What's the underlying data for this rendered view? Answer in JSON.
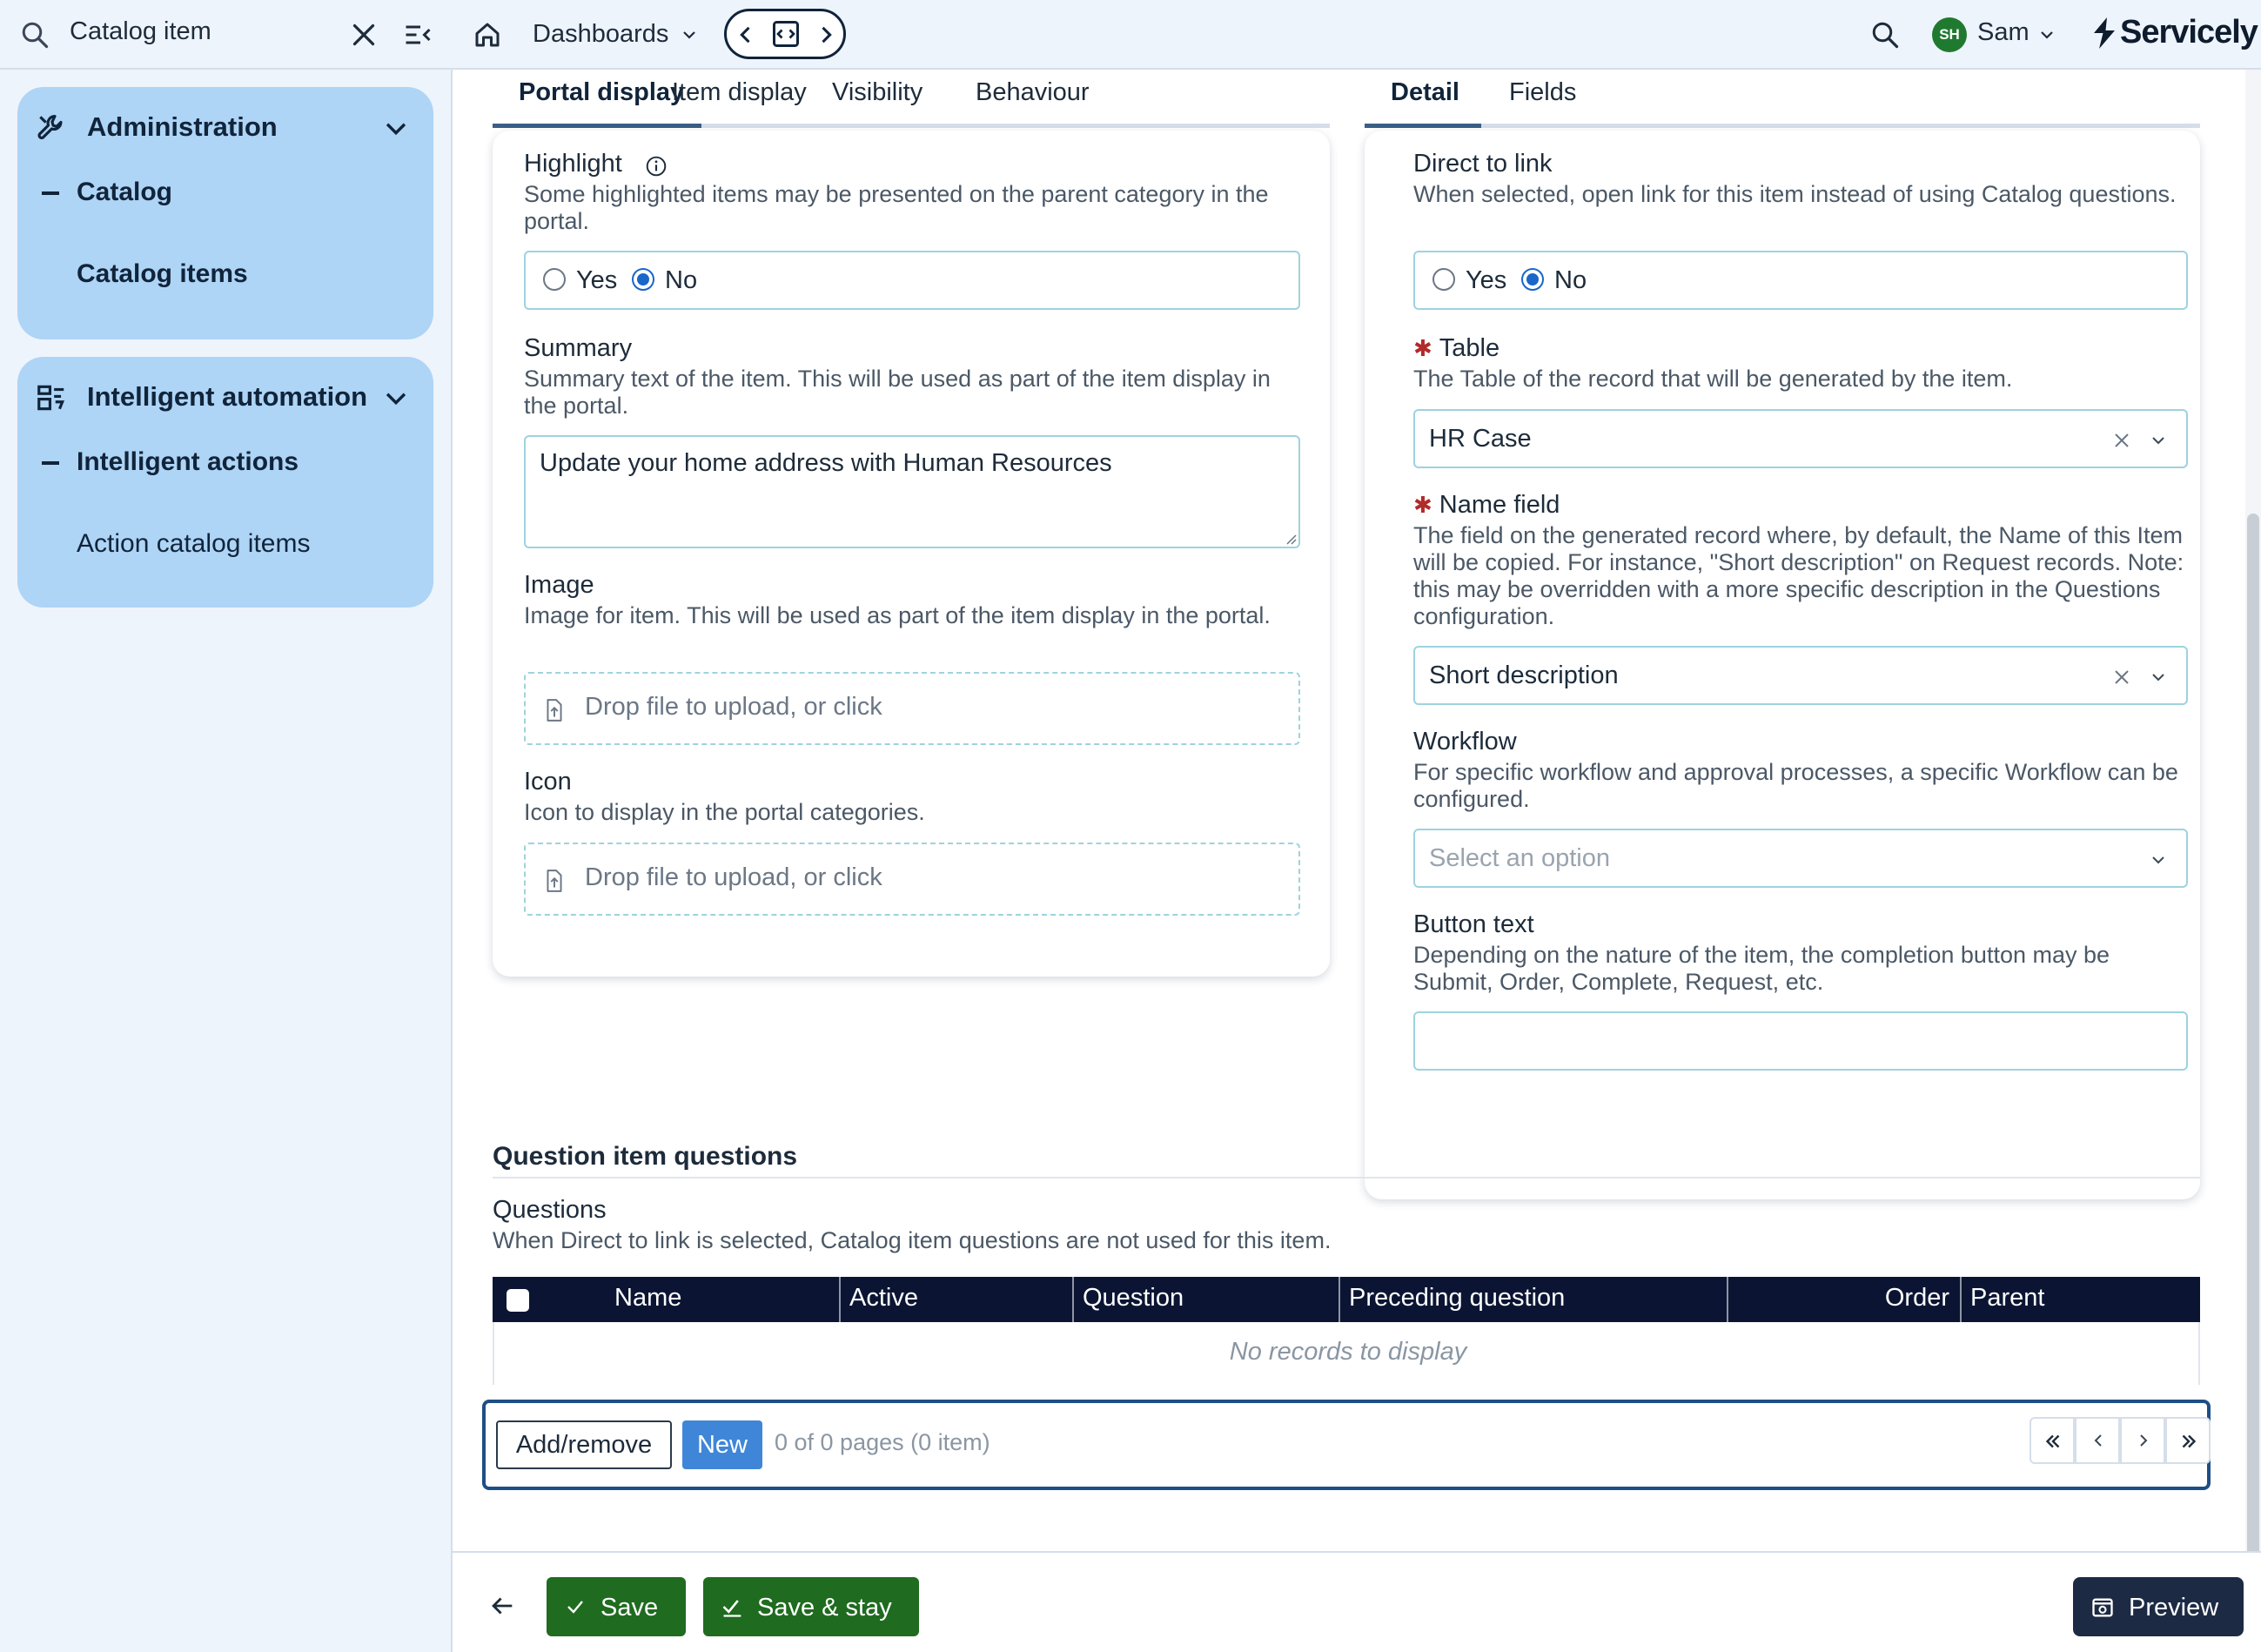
{
  "sidebar": {
    "search_value": "Catalog item",
    "groups": [
      {
        "title": "Administration",
        "sub": "Catalog",
        "leaf": "Catalog items"
      },
      {
        "title": "Intelligent automation",
        "sub": "Intelligent actions",
        "leaf": "Action catalog items"
      }
    ]
  },
  "topbar": {
    "dashboards_label": "Dashboards",
    "user_initials": "SH",
    "user_name": "Sam",
    "brand": "Servicely"
  },
  "left_tabs": [
    "Portal display",
    "Item display",
    "Visibility",
    "Behaviour"
  ],
  "right_tabs": [
    "Detail",
    "Fields"
  ],
  "portal": {
    "highlight": {
      "label": "Highlight",
      "help": "Some highlighted items may be presented on the parent category in the portal.",
      "yes": "Yes",
      "no": "No",
      "selected": "No"
    },
    "summary": {
      "label": "Summary",
      "help": "Summary text of the item. This will be used as part of the item display in the portal.",
      "value": "Update your home address with Human Resources"
    },
    "image": {
      "label": "Image",
      "help": "Image for item. This will be used as part of the item display in the portal.",
      "upload": "Drop file to upload, or click"
    },
    "icon": {
      "label": "Icon",
      "help": "Icon to display in the portal categories.",
      "upload": "Drop file to upload, or click"
    }
  },
  "detail": {
    "direct_to_link": {
      "label": "Direct to link",
      "help": "When selected, open link for this item instead of using Catalog questions.",
      "yes": "Yes",
      "no": "No",
      "selected": "No"
    },
    "table": {
      "label": "Table",
      "help": "The Table of the record that will be generated by the item.",
      "value": "HR Case"
    },
    "name_field": {
      "label": "Name field",
      "help": "The field on the generated record where, by default, the Name of this Item will be copied. For instance, \"Short description\" on Request records. Note: this may be overridden with a more specific description in the Questions configuration.",
      "value": "Short description"
    },
    "workflow": {
      "label": "Workflow",
      "help": "For specific workflow and approval processes, a specific Workflow can be configured.",
      "placeholder": "Select an option"
    },
    "button_text": {
      "label": "Button text",
      "help": "Depending on the nature of the item, the completion button may be Submit, Order, Complete, Request, etc.",
      "value": ""
    }
  },
  "questions": {
    "section_title": "Question item questions",
    "label": "Questions",
    "help": "When Direct to link is selected, Catalog item questions are not used for this item.",
    "columns": [
      "Name",
      "Active",
      "Question",
      "Preceding question",
      "Order",
      "Parent"
    ],
    "empty_text": "No records to display",
    "add_remove": "Add/remove",
    "new": "New",
    "pagination": "0 of 0 pages (0 item)"
  },
  "footer": {
    "save": "Save",
    "save_stay": "Save & stay",
    "preview": "Preview"
  },
  "colors": {
    "accent": "#3f86d8",
    "save_green": "#1f6b1f",
    "header_navy": "#0b1533",
    "sidebar_group": "#aed4f6"
  }
}
